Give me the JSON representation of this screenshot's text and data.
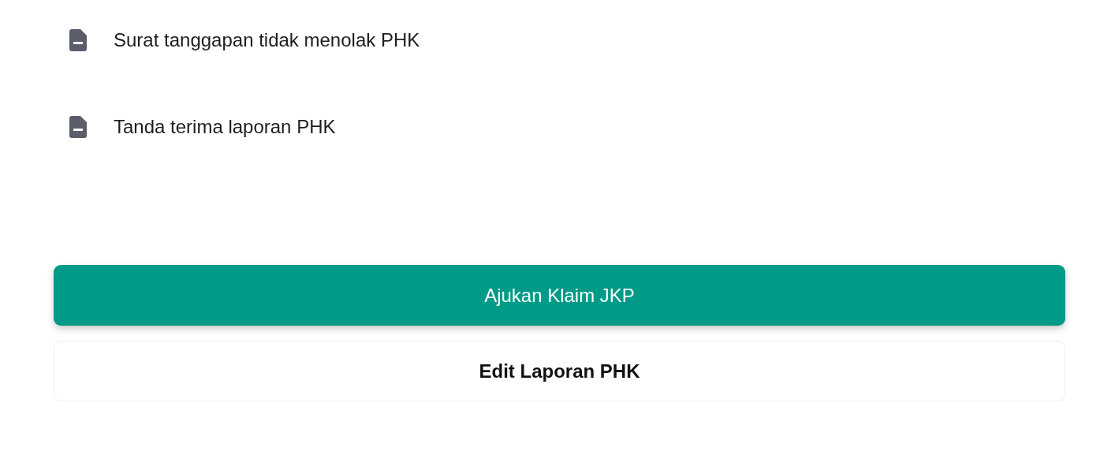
{
  "documents": [
    {
      "label": "Surat tanggapan tidak menolak PHK"
    },
    {
      "label": "Tanda terima laporan PHK"
    }
  ],
  "buttons": [
    {
      "kind": "primary",
      "label": "Ajukan Klaim JKP"
    },
    {
      "kind": "secondary",
      "label": "Edit Laporan PHK"
    }
  ]
}
